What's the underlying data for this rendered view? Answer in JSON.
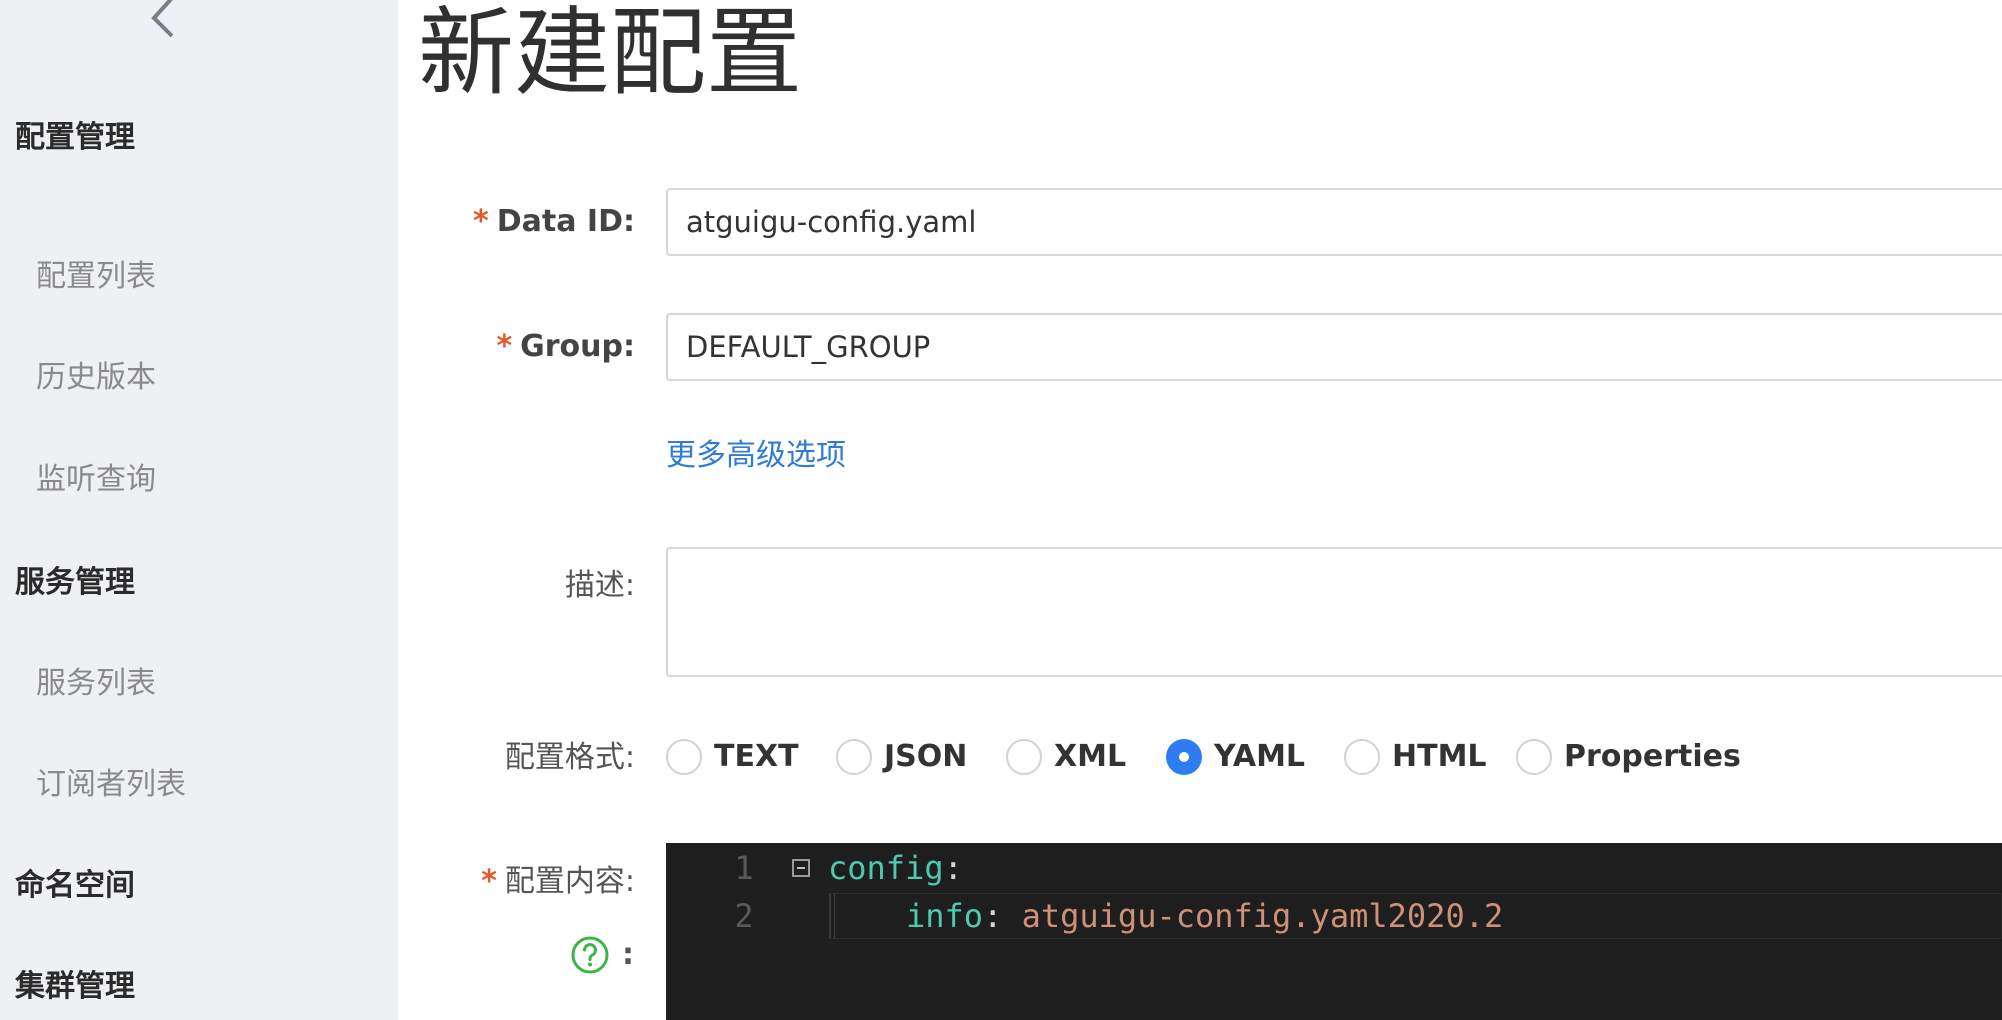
{
  "sidebar": {
    "back_icon": "chevron-left-icon",
    "items": [
      {
        "label": "配置管理",
        "type": "group"
      },
      {
        "label": "配置列表",
        "type": "sub"
      },
      {
        "label": "历史版本",
        "type": "sub"
      },
      {
        "label": "监听查询",
        "type": "sub"
      },
      {
        "label": "服务管理",
        "type": "group"
      },
      {
        "label": "服务列表",
        "type": "sub"
      },
      {
        "label": "订阅者列表",
        "type": "sub"
      },
      {
        "label": "命名空间",
        "type": "group"
      },
      {
        "label": "集群管理",
        "type": "group"
      }
    ]
  },
  "page": {
    "title": "新建配置"
  },
  "form": {
    "data_id": {
      "required_mark": "*",
      "label": "Data ID:",
      "value": "atguigu-config.yaml"
    },
    "group": {
      "required_mark": "*",
      "label": "Group:",
      "value": "DEFAULT_GROUP"
    },
    "advanced_link": "更多高级选项",
    "description": {
      "label": "描述:",
      "value": ""
    },
    "format": {
      "label": "配置格式:",
      "options": [
        "TEXT",
        "JSON",
        "XML",
        "YAML",
        "HTML",
        "Properties"
      ],
      "selected": "YAML"
    },
    "content": {
      "required_mark": "*",
      "label": "配置内容:",
      "help_colon": ":",
      "help_icon": "question-circle-icon",
      "lines": [
        {
          "num": "1",
          "key": "config",
          "colon": ":",
          "value": ""
        },
        {
          "num": "2",
          "key": "info",
          "colon": ":",
          "value": " atguigu-config.yaml2020.2"
        }
      ]
    }
  },
  "colors": {
    "sidebar_bg": "#eef0f3",
    "link": "#2f7bd6",
    "radio_checked": "#2f7bf0",
    "required": "#e25a2a",
    "editor_bg": "#1e1e1e",
    "code_key": "#4ec9b0",
    "code_value": "#ce9178",
    "help_icon": "#3bb54a"
  }
}
